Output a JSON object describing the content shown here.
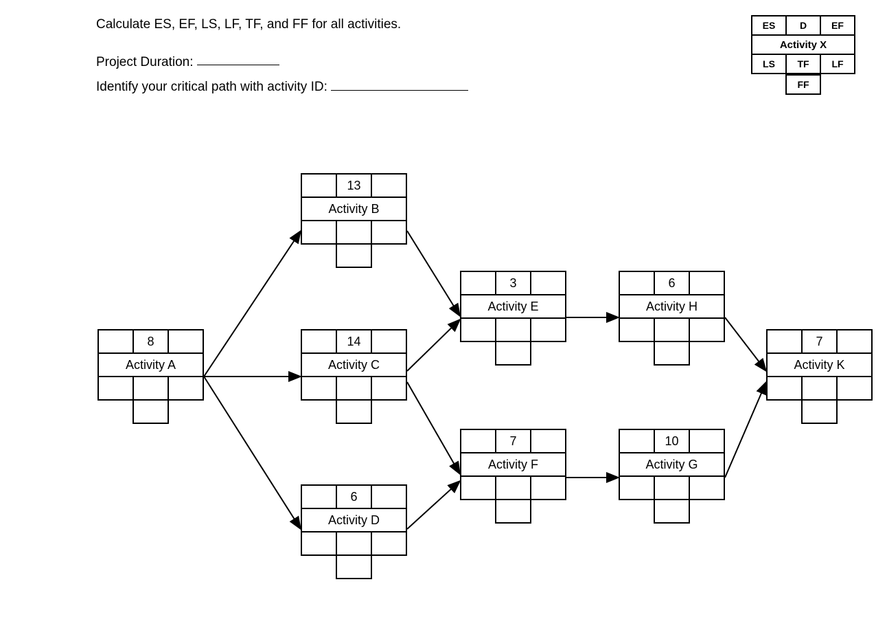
{
  "instructions": {
    "line1": "Calculate ES, EF, LS, LF, TF, and FF for all activities.",
    "line2_pre": "Project Duration: ",
    "line3_pre": "Identify your critical path with activity ID: "
  },
  "legend": {
    "ES": "ES",
    "D": "D",
    "EF": "EF",
    "name": "Activity X",
    "LS": "LS",
    "TF": "TF",
    "LF": "LF",
    "FF": "FF"
  },
  "activities": {
    "A": {
      "name": "Activity A",
      "D": "8"
    },
    "B": {
      "name": "Activity B",
      "D": "13"
    },
    "C": {
      "name": "Activity C",
      "D": "14"
    },
    "D": {
      "name": "Activity D",
      "D": "6"
    },
    "E": {
      "name": "Activity E",
      "D": "3"
    },
    "F": {
      "name": "Activity F",
      "D": "7"
    },
    "G": {
      "name": "Activity G",
      "D": "10"
    },
    "H": {
      "name": "Activity H",
      "D": "6"
    },
    "K": {
      "name": "Activity K",
      "D": "7"
    }
  },
  "chart_data": {
    "type": "table",
    "title": "Activity-on-Node Network Diagram",
    "node_legend": [
      "ES",
      "D",
      "EF",
      "Activity",
      "LS",
      "TF",
      "LF",
      "FF"
    ],
    "nodes": [
      {
        "id": "A",
        "name": "Activity A",
        "duration": 8,
        "ES": null,
        "EF": null,
        "LS": null,
        "TF": null,
        "LF": null,
        "FF": null
      },
      {
        "id": "B",
        "name": "Activity B",
        "duration": 13,
        "ES": null,
        "EF": null,
        "LS": null,
        "TF": null,
        "LF": null,
        "FF": null
      },
      {
        "id": "C",
        "name": "Activity C",
        "duration": 14,
        "ES": null,
        "EF": null,
        "LS": null,
        "TF": null,
        "LF": null,
        "FF": null
      },
      {
        "id": "D",
        "name": "Activity D",
        "duration": 6,
        "ES": null,
        "EF": null,
        "LS": null,
        "TF": null,
        "LF": null,
        "FF": null
      },
      {
        "id": "E",
        "name": "Activity E",
        "duration": 3,
        "ES": null,
        "EF": null,
        "LS": null,
        "TF": null,
        "LF": null,
        "FF": null
      },
      {
        "id": "F",
        "name": "Activity F",
        "duration": 7,
        "ES": null,
        "EF": null,
        "LS": null,
        "TF": null,
        "LF": null,
        "FF": null
      },
      {
        "id": "G",
        "name": "Activity G",
        "duration": 10,
        "ES": null,
        "EF": null,
        "LS": null,
        "TF": null,
        "LF": null,
        "FF": null
      },
      {
        "id": "H",
        "name": "Activity H",
        "duration": 6,
        "ES": null,
        "EF": null,
        "LS": null,
        "TF": null,
        "LF": null,
        "FF": null
      },
      {
        "id": "K",
        "name": "Activity K",
        "duration": 7,
        "ES": null,
        "EF": null,
        "LS": null,
        "TF": null,
        "LF": null,
        "FF": null
      }
    ],
    "edges": [
      {
        "from": "A",
        "to": "B"
      },
      {
        "from": "A",
        "to": "C"
      },
      {
        "from": "A",
        "to": "D"
      },
      {
        "from": "B",
        "to": "E"
      },
      {
        "from": "C",
        "to": "E"
      },
      {
        "from": "C",
        "to": "F"
      },
      {
        "from": "D",
        "to": "F"
      },
      {
        "from": "E",
        "to": "H"
      },
      {
        "from": "F",
        "to": "G"
      },
      {
        "from": "H",
        "to": "K"
      },
      {
        "from": "G",
        "to": "K"
      }
    ],
    "project_duration": null,
    "critical_path": null
  }
}
